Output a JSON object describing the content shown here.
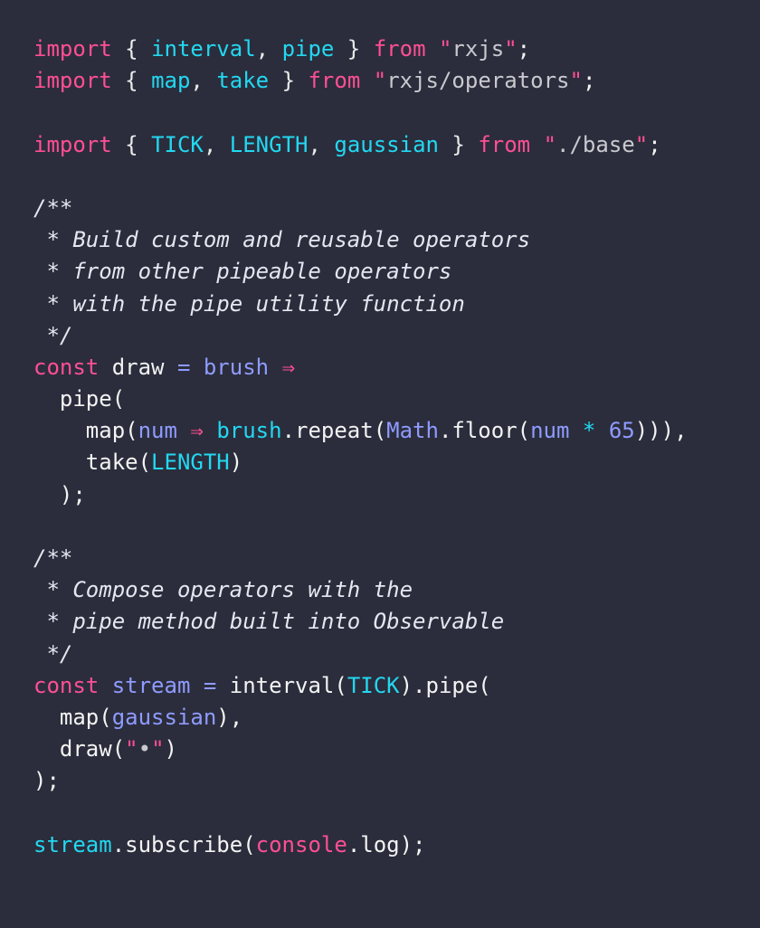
{
  "colors": {
    "background": "#2b2d3c",
    "keyword": "#ff4f94",
    "identifier": "#23d8f1",
    "variable": "#8f9bff",
    "text": "#f3f3f3",
    "string": "#c9c9cf"
  },
  "editor": {
    "language": "javascript",
    "lines": [
      {
        "name": "import-rxjs",
        "tokens": [
          {
            "t": "import",
            "c": "keyword"
          },
          {
            "t": " { ",
            "c": "punct"
          },
          {
            "t": "interval",
            "c": "ident"
          },
          {
            "t": ", ",
            "c": "punct"
          },
          {
            "t": "pipe",
            "c": "ident"
          },
          {
            "t": " } ",
            "c": "punct"
          },
          {
            "t": "from",
            "c": "keyword"
          },
          {
            "t": " ",
            "c": "plain"
          },
          {
            "t": "\"",
            "c": "quote"
          },
          {
            "t": "rxjs",
            "c": "string"
          },
          {
            "t": "\"",
            "c": "quote"
          },
          {
            "t": ";",
            "c": "plain"
          }
        ]
      },
      {
        "name": "import-operators",
        "tokens": [
          {
            "t": "import",
            "c": "keyword"
          },
          {
            "t": " { ",
            "c": "punct"
          },
          {
            "t": "map",
            "c": "ident"
          },
          {
            "t": ", ",
            "c": "punct"
          },
          {
            "t": "take",
            "c": "ident"
          },
          {
            "t": " } ",
            "c": "punct"
          },
          {
            "t": "from",
            "c": "keyword"
          },
          {
            "t": " ",
            "c": "plain"
          },
          {
            "t": "\"",
            "c": "quote"
          },
          {
            "t": "rxjs/operators",
            "c": "string"
          },
          {
            "t": "\"",
            "c": "quote"
          },
          {
            "t": ";",
            "c": "plain"
          }
        ]
      },
      {
        "name": "blank",
        "tokens": []
      },
      {
        "name": "import-base",
        "tokens": [
          {
            "t": "import",
            "c": "keyword"
          },
          {
            "t": " { ",
            "c": "punct"
          },
          {
            "t": "TICK",
            "c": "ident"
          },
          {
            "t": ", ",
            "c": "punct"
          },
          {
            "t": "LENGTH",
            "c": "ident"
          },
          {
            "t": ", ",
            "c": "punct"
          },
          {
            "t": "gaussian",
            "c": "ident"
          },
          {
            "t": " } ",
            "c": "punct"
          },
          {
            "t": "from",
            "c": "keyword"
          },
          {
            "t": " ",
            "c": "plain"
          },
          {
            "t": "\"",
            "c": "quote"
          },
          {
            "t": "./base",
            "c": "string"
          },
          {
            "t": "\"",
            "c": "quote"
          },
          {
            "t": ";",
            "c": "plain"
          }
        ]
      },
      {
        "name": "blank",
        "tokens": []
      },
      {
        "name": "comment",
        "tokens": [
          {
            "t": "/**",
            "c": "comment"
          }
        ]
      },
      {
        "name": "comment",
        "tokens": [
          {
            "t": " * Build custom and reusable operators",
            "c": "comment"
          }
        ]
      },
      {
        "name": "comment",
        "tokens": [
          {
            "t": " * from other pipeable operators",
            "c": "comment"
          }
        ]
      },
      {
        "name": "comment",
        "tokens": [
          {
            "t": " * with the pipe utility function",
            "c": "comment"
          }
        ]
      },
      {
        "name": "comment",
        "tokens": [
          {
            "t": " */",
            "c": "comment"
          }
        ]
      },
      {
        "name": "const-draw",
        "tokens": [
          {
            "t": "const",
            "c": "keyword"
          },
          {
            "t": " ",
            "c": "plain"
          },
          {
            "t": "draw",
            "c": "plain"
          },
          {
            "t": " ",
            "c": "plain"
          },
          {
            "t": "=",
            "c": "opblue"
          },
          {
            "t": " ",
            "c": "plain"
          },
          {
            "t": "brush",
            "c": "var"
          },
          {
            "t": " ",
            "c": "plain"
          },
          {
            "t": "⇒",
            "c": "op"
          }
        ]
      },
      {
        "name": "code",
        "tokens": [
          {
            "t": "  pipe(",
            "c": "plain"
          }
        ]
      },
      {
        "name": "code",
        "tokens": [
          {
            "t": "    map(",
            "c": "plain"
          },
          {
            "t": "num",
            "c": "var"
          },
          {
            "t": " ",
            "c": "plain"
          },
          {
            "t": "⇒",
            "c": "op"
          },
          {
            "t": " ",
            "c": "plain"
          },
          {
            "t": "brush",
            "c": "cyan"
          },
          {
            "t": ".repeat(",
            "c": "plain"
          },
          {
            "t": "Math",
            "c": "global"
          },
          {
            "t": ".floor(",
            "c": "plain"
          },
          {
            "t": "num",
            "c": "var"
          },
          {
            "t": " ",
            "c": "plain"
          },
          {
            "t": "*",
            "c": "cyan"
          },
          {
            "t": " ",
            "c": "plain"
          },
          {
            "t": "65",
            "c": "number"
          },
          {
            "t": "))),",
            "c": "plain"
          }
        ]
      },
      {
        "name": "code",
        "tokens": [
          {
            "t": "    take(",
            "c": "plain"
          },
          {
            "t": "LENGTH",
            "c": "cyan"
          },
          {
            "t": ")",
            "c": "plain"
          }
        ]
      },
      {
        "name": "code",
        "tokens": [
          {
            "t": "  );",
            "c": "plain"
          }
        ]
      },
      {
        "name": "blank",
        "tokens": []
      },
      {
        "name": "comment",
        "tokens": [
          {
            "t": "/**",
            "c": "comment"
          }
        ]
      },
      {
        "name": "comment",
        "tokens": [
          {
            "t": " * Compose operators with the",
            "c": "comment"
          }
        ]
      },
      {
        "name": "comment",
        "tokens": [
          {
            "t": " * pipe method built into Observable",
            "c": "comment"
          }
        ]
      },
      {
        "name": "comment",
        "tokens": [
          {
            "t": " */",
            "c": "comment"
          }
        ]
      },
      {
        "name": "const-stream",
        "tokens": [
          {
            "t": "const",
            "c": "keyword"
          },
          {
            "t": " ",
            "c": "plain"
          },
          {
            "t": "stream",
            "c": "var"
          },
          {
            "t": " ",
            "c": "plain"
          },
          {
            "t": "=",
            "c": "opblue"
          },
          {
            "t": " ",
            "c": "plain"
          },
          {
            "t": "interval(",
            "c": "plain"
          },
          {
            "t": "TICK",
            "c": "cyan"
          },
          {
            "t": ").pipe(",
            "c": "plain"
          }
        ]
      },
      {
        "name": "code",
        "tokens": [
          {
            "t": "  map(",
            "c": "plain"
          },
          {
            "t": "gaussian",
            "c": "var"
          },
          {
            "t": "),",
            "c": "plain"
          }
        ]
      },
      {
        "name": "code",
        "tokens": [
          {
            "t": "  draw(",
            "c": "plain"
          },
          {
            "t": "\"",
            "c": "quote"
          },
          {
            "t": "•",
            "c": "string"
          },
          {
            "t": "\"",
            "c": "quote"
          },
          {
            "t": ")",
            "c": "plain"
          }
        ]
      },
      {
        "name": "code",
        "tokens": [
          {
            "t": ");",
            "c": "plain"
          }
        ]
      },
      {
        "name": "blank",
        "tokens": []
      },
      {
        "name": "subscribe",
        "tokens": [
          {
            "t": "stream",
            "c": "cyan"
          },
          {
            "t": ".subscribe(",
            "c": "plain"
          },
          {
            "t": "console",
            "c": "console"
          },
          {
            "t": ".log);",
            "c": "plain"
          }
        ]
      }
    ]
  }
}
